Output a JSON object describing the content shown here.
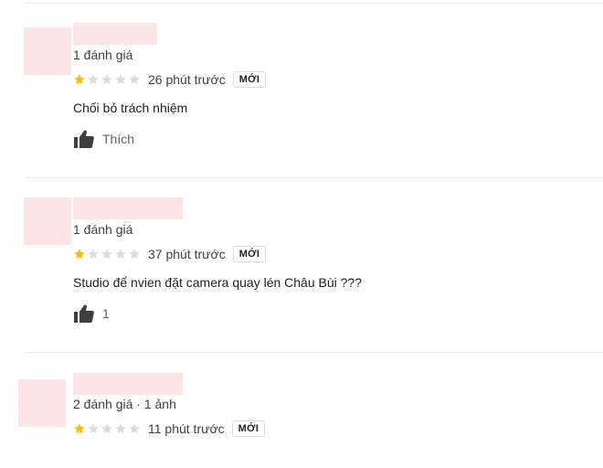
{
  "reviews": [
    {
      "stats": "1 đánh giá",
      "rating": 1,
      "max_rating": 5,
      "time": "26 phút trước",
      "badge": "MỚI",
      "text": "Chối bỏ trách nhiệm",
      "like_label": "Thích"
    },
    {
      "stats": "1 đánh giá",
      "rating": 1,
      "max_rating": 5,
      "time": "37 phút trước",
      "badge": "MỚI",
      "text": "Studio để nvien đặt camera quay lén Châu Bùi ???",
      "like_label": "1"
    },
    {
      "stats": "2 đánh giá · 1 ảnh",
      "rating": 1,
      "max_rating": 5,
      "time": "11 phút trước",
      "badge": "MỚI"
    }
  ],
  "colors": {
    "star_filled": "#fbbc04",
    "star_empty": "#dadce0",
    "redaction": "#fde4e4"
  }
}
